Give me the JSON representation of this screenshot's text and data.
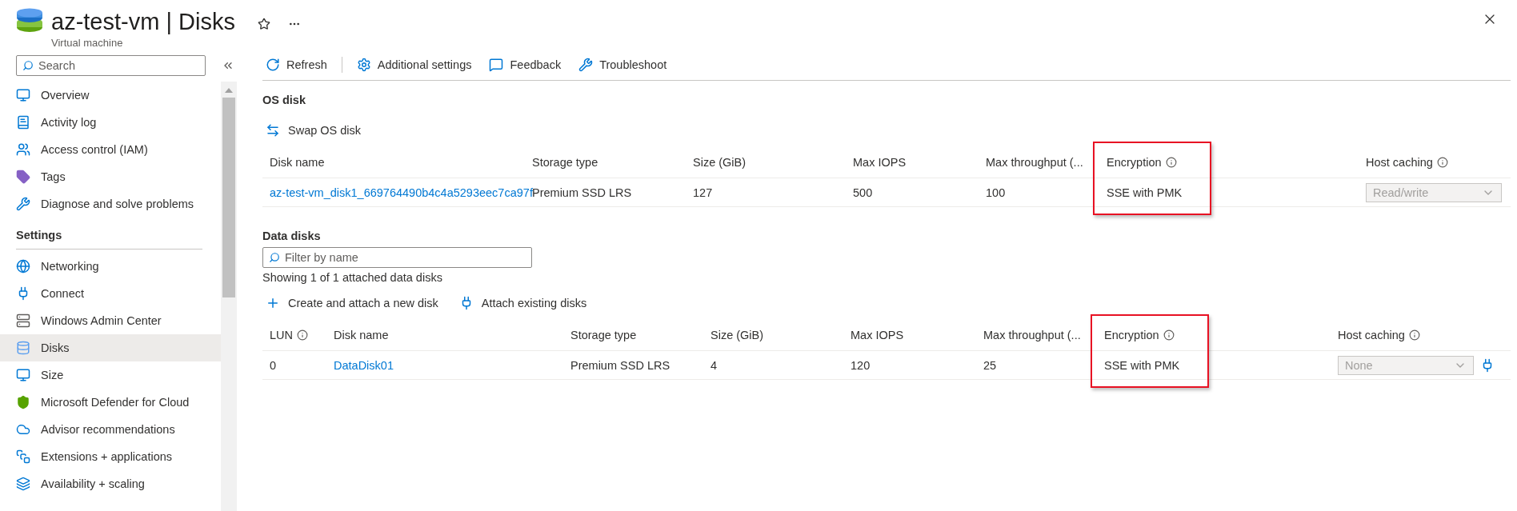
{
  "header": {
    "title": "az-test-vm | Disks",
    "subtitle": "Virtual machine"
  },
  "sidebar": {
    "search": {
      "placeholder": "Search"
    },
    "items": [
      {
        "kind": "link",
        "label": "Overview",
        "selected": false
      },
      {
        "kind": "link",
        "label": "Activity log",
        "selected": false
      },
      {
        "kind": "link",
        "label": "Access control (IAM)",
        "selected": false
      },
      {
        "kind": "link",
        "label": "Tags",
        "selected": false
      },
      {
        "kind": "link",
        "label": "Diagnose and solve problems",
        "selected": false
      },
      {
        "kind": "heading",
        "label": "Settings"
      },
      {
        "kind": "link",
        "label": "Networking",
        "selected": false
      },
      {
        "kind": "link",
        "label": "Connect",
        "selected": false
      },
      {
        "kind": "link",
        "label": "Windows Admin Center",
        "selected": false
      },
      {
        "kind": "link",
        "label": "Disks",
        "selected": true
      },
      {
        "kind": "link",
        "label": "Size",
        "selected": false
      },
      {
        "kind": "link",
        "label": "Microsoft Defender for Cloud",
        "selected": false
      },
      {
        "kind": "link",
        "label": "Advisor recommendations",
        "selected": false
      },
      {
        "kind": "link",
        "label": "Extensions + applications",
        "selected": false
      },
      {
        "kind": "link",
        "label": "Availability + scaling",
        "selected": false
      }
    ]
  },
  "toolbar": [
    "Refresh",
    "Additional settings",
    "Feedback",
    "Troubleshoot"
  ],
  "os_disk": {
    "title": "OS disk",
    "actions": [
      "Swap OS disk"
    ],
    "columns": [
      {
        "label": "Disk name",
        "kind": "link",
        "info": false,
        "highlighted": false
      },
      {
        "label": "Storage type",
        "kind": "text",
        "info": false,
        "highlighted": false
      },
      {
        "label": "Size (GiB)",
        "kind": "text",
        "info": false,
        "highlighted": false
      },
      {
        "label": "Max IOPS",
        "kind": "text",
        "info": false,
        "highlighted": false
      },
      {
        "label": "Max throughput (...",
        "kind": "text",
        "info": false,
        "highlighted": false
      },
      {
        "label": "Encryption",
        "kind": "text",
        "info": true,
        "highlighted": true
      },
      {
        "label": "Host caching",
        "kind": "dropdown",
        "info": true,
        "highlighted": false
      }
    ],
    "rows": [
      {
        "cells": [
          "az-test-vm_disk1_669764490b4c4a5293eec7ca97f",
          "Premium SSD LRS",
          "127",
          "500",
          "100",
          "SSE with PMK",
          "Read/write"
        ],
        "disabled": true
      }
    ]
  },
  "data_disks": {
    "title": "Data disks",
    "filter": {
      "placeholder": "Filter by name"
    },
    "count": "Showing 1 of 1 attached data disks",
    "actions": [
      "Create and attach a new disk",
      "Attach existing disks"
    ],
    "columns": [
      {
        "label": "LUN",
        "kind": "text",
        "info": true,
        "highlighted": false
      },
      {
        "label": "Disk name",
        "kind": "link",
        "info": false,
        "highlighted": false
      },
      {
        "label": "Storage type",
        "kind": "text",
        "info": false,
        "highlighted": false
      },
      {
        "label": "Size (GiB)",
        "kind": "text",
        "info": false,
        "highlighted": false
      },
      {
        "label": "Max IOPS",
        "kind": "text",
        "info": false,
        "highlighted": false
      },
      {
        "label": "Max throughput (...",
        "kind": "text",
        "info": false,
        "highlighted": false
      },
      {
        "label": "Encryption",
        "kind": "text",
        "info": true,
        "highlighted": true
      },
      {
        "label": "Host caching",
        "kind": "dropdown_detach",
        "info": true,
        "highlighted": false
      }
    ],
    "rows": [
      {
        "cells": [
          "0",
          "DataDisk01",
          "Premium SSD LRS",
          "4",
          "120",
          "25",
          "SSE with PMK",
          "None"
        ],
        "disabled": true
      }
    ]
  }
}
